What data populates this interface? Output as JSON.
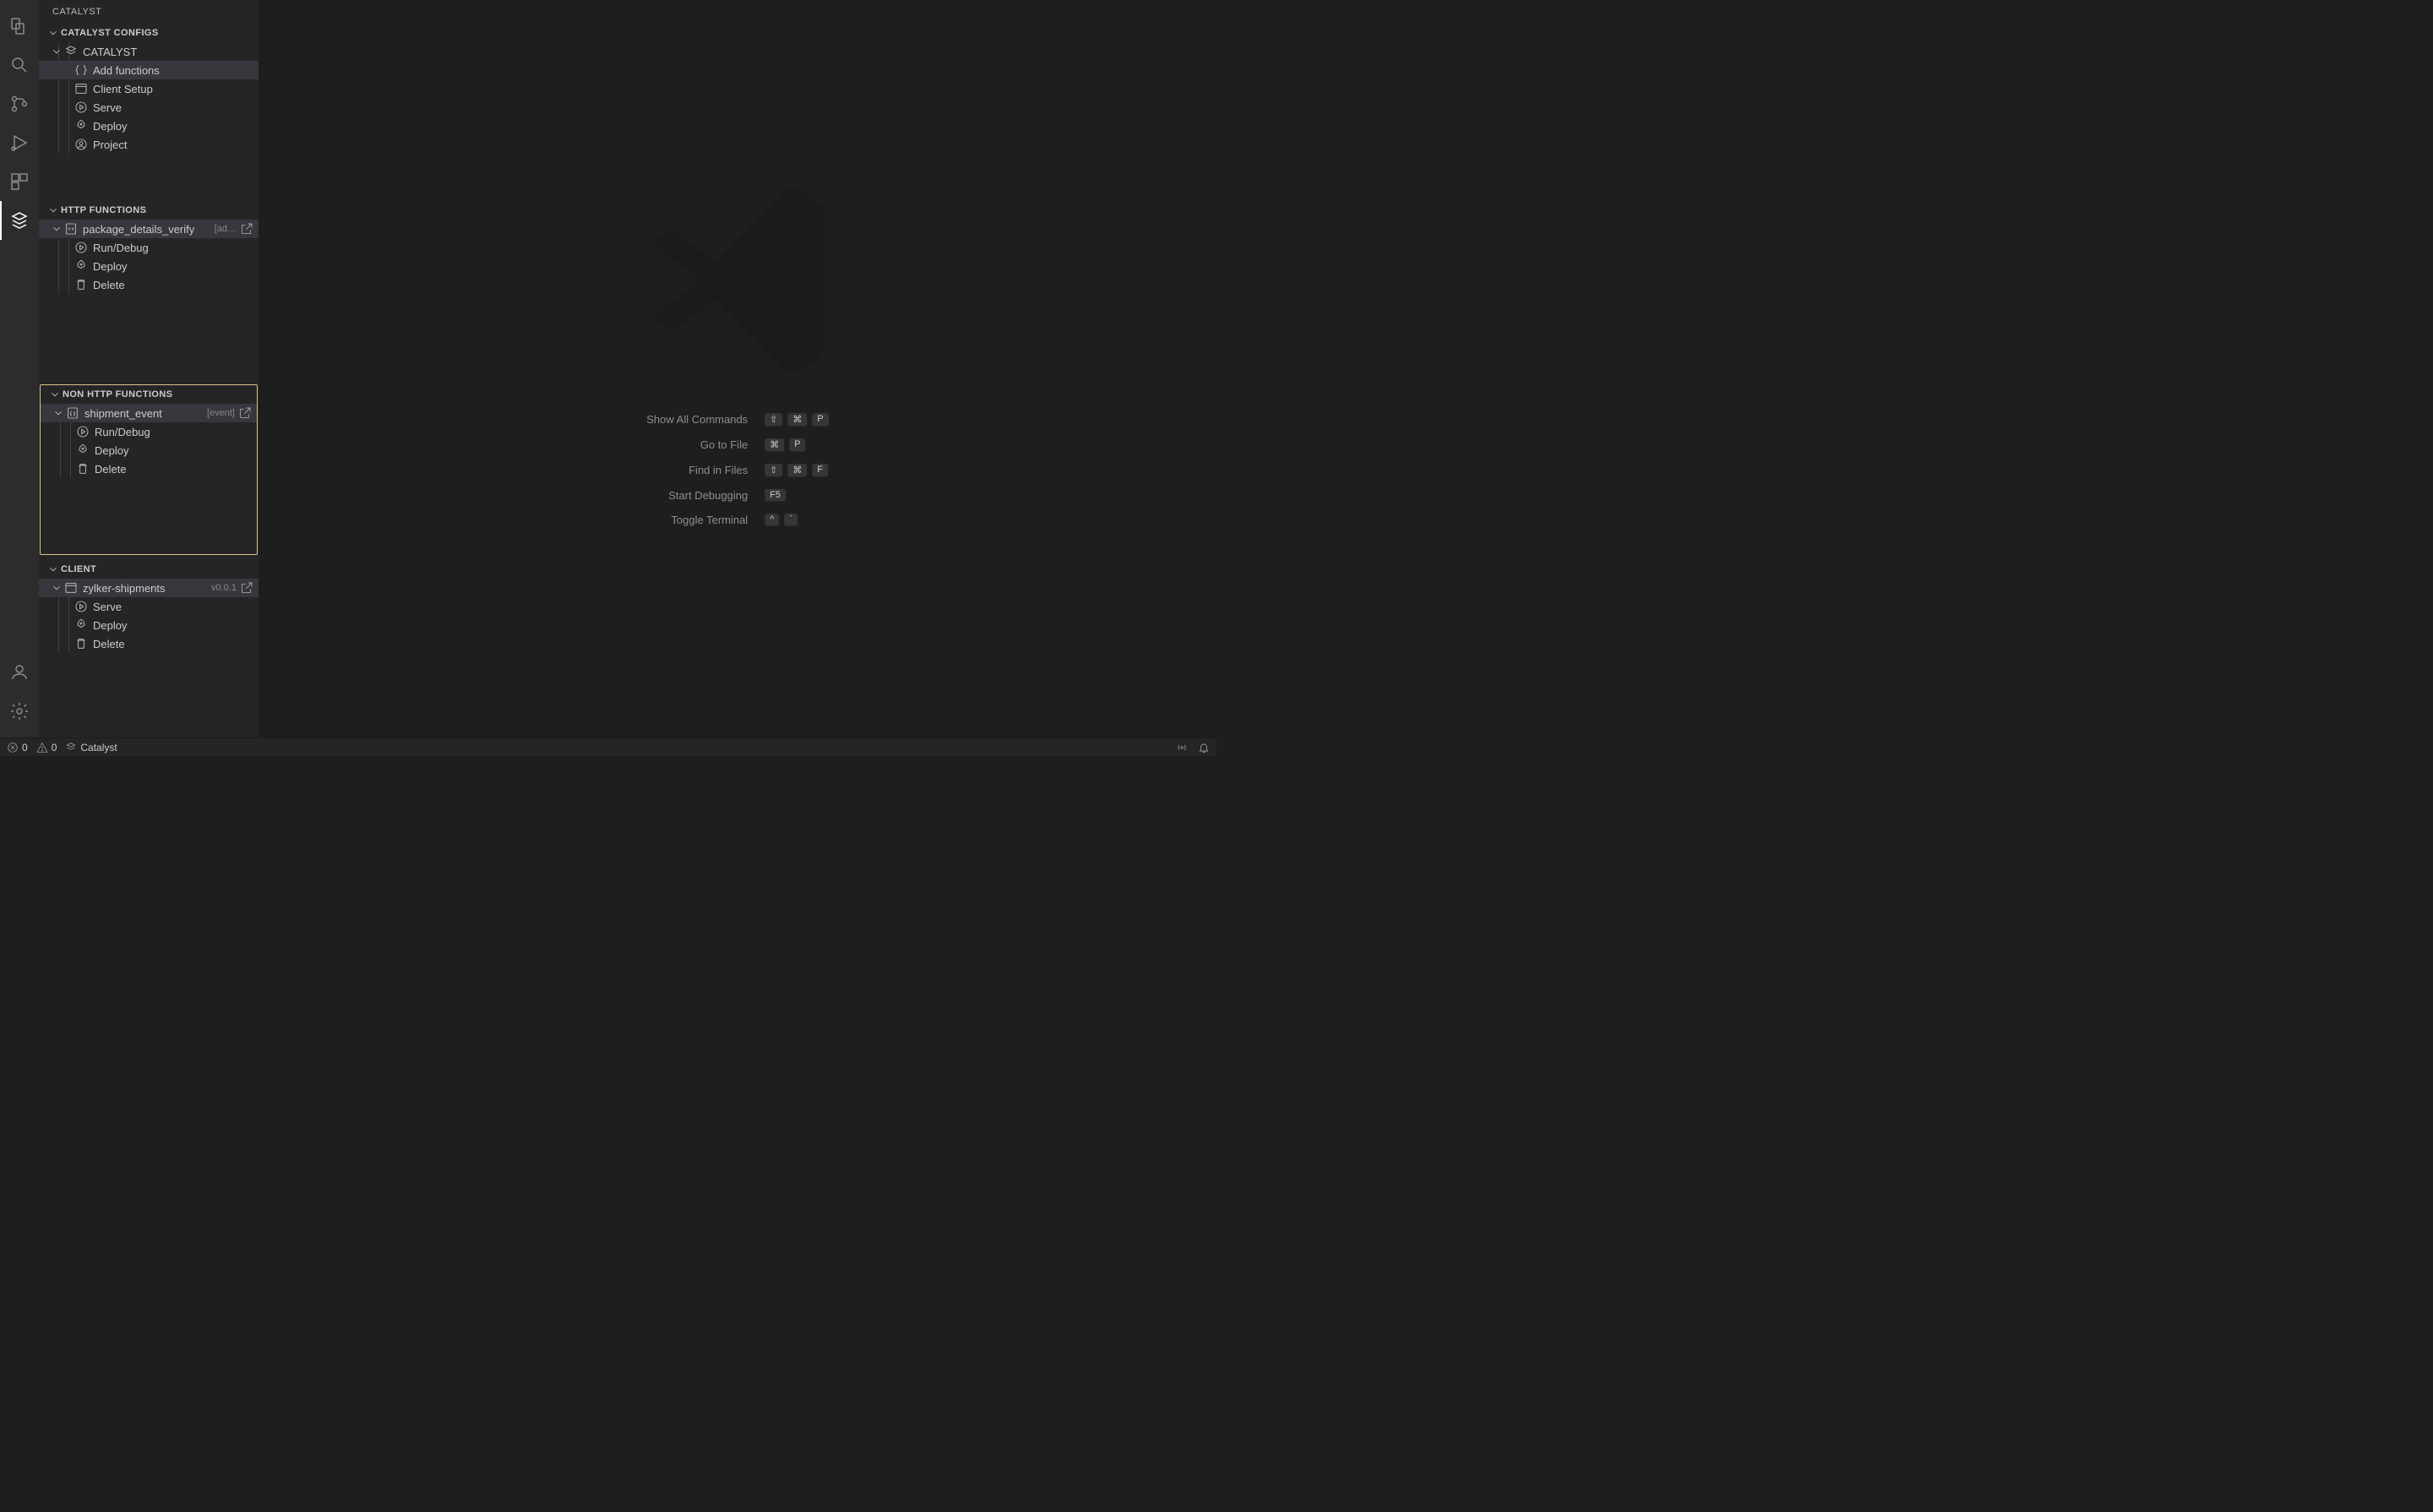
{
  "sidebar_title": "CATALYST",
  "sections": {
    "configs": {
      "title": "CATALYST CONFIGS",
      "root": "CATALYST",
      "items": [
        {
          "label": "Add functions"
        },
        {
          "label": "Client Setup"
        },
        {
          "label": "Serve"
        },
        {
          "label": "Deploy"
        },
        {
          "label": "Project"
        }
      ]
    },
    "http": {
      "title": "HTTP FUNCTIONS",
      "root": "package_details_verify",
      "root_meta": "[ad…",
      "items": [
        {
          "label": "Run/Debug"
        },
        {
          "label": "Deploy"
        },
        {
          "label": "Delete"
        }
      ]
    },
    "nonhttp": {
      "title": "NON HTTP FUNCTIONS",
      "root": "shipment_event",
      "root_meta": "[event]",
      "items": [
        {
          "label": "Run/Debug"
        },
        {
          "label": "Deploy"
        },
        {
          "label": "Delete"
        }
      ]
    },
    "client": {
      "title": "CLIENT",
      "root": "zylker-shipments",
      "root_meta": "v0.0.1",
      "items": [
        {
          "label": "Serve"
        },
        {
          "label": "Deploy"
        },
        {
          "label": "Delete"
        }
      ]
    }
  },
  "editor_shortcuts": [
    {
      "label": "Show All Commands",
      "keys": [
        "⇧",
        "⌘",
        "P"
      ]
    },
    {
      "label": "Go to File",
      "keys": [
        "⌘",
        "P"
      ]
    },
    {
      "label": "Find in Files",
      "keys": [
        "⇧",
        "⌘",
        "F"
      ]
    },
    {
      "label": "Start Debugging",
      "keys": [
        "F5"
      ]
    },
    {
      "label": "Toggle Terminal",
      "keys": [
        "^",
        "`"
      ]
    }
  ],
  "status_bar": {
    "errors": "0",
    "warnings": "0",
    "catalyst": "Catalyst"
  }
}
